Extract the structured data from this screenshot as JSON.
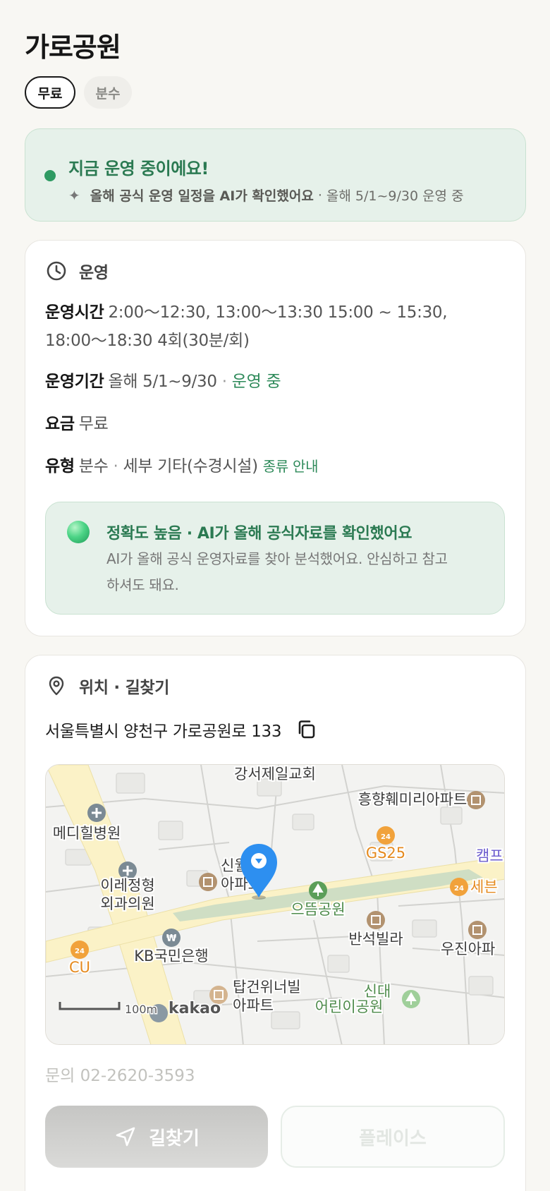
{
  "place": {
    "title": "가로공원",
    "chips": [
      {
        "label": "무료",
        "active": true
      },
      {
        "label": "분수",
        "active": false
      }
    ]
  },
  "status": {
    "title": "지금 운영 중이에요!",
    "ai_note": "올해 공식 운영 일정을 AI가 확인했어요",
    "dot_sep": "·",
    "period_note": "올해 5/1~9/30 운영 중",
    "accent_color": "#2b7a52"
  },
  "operation": {
    "section_label": "운영",
    "hours_key": "운영시간",
    "hours_value": "2:00～12:30, 13:00～13:30 15:00 ~ 15:30, 18:00～18:30 4회(30분/회)",
    "period_key": "운영기간",
    "period_value": "올해 5/1~9/30",
    "period_sep": "·",
    "period_status": "운영 중",
    "fee_key": "요금",
    "fee_value": "무료",
    "type_key": "유형",
    "type_value": "분수",
    "type_sep": "·",
    "type_detail": "세부 기타(수경시설)",
    "type_link": "종류 안내",
    "accuracy_title": "정확도 높음 · AI가 올해 공식자료를 확인했어요",
    "accuracy_body": "AI가 올해 공식 운영자료를 찾아 분석했어요. 안심하고 참고하셔도 돼요."
  },
  "location": {
    "section_label": "위치 · 길찾기",
    "address": "서울특별시 양천구 가로공원로 133",
    "map_labels": {
      "church": "강서제일교회",
      "apt1": "흥향훼미리아파트",
      "hospital": "메디힐병원",
      "gs25": "GS25",
      "camp": "캠프",
      "clinic_l1": "이레정형",
      "clinic_l2": "외과의원",
      "sinwol_l1": "신월하",
      "sinwol_l2": "아파트",
      "park": "으뜸공원",
      "seven": "세븐",
      "banseok": "반석빌라",
      "ujin": "우진아파",
      "kb": "KB국민은행",
      "cu": "CU",
      "tapgeon_l1": "탑건위너빌",
      "tapgeon_l2": "아파트",
      "sindae_l1": "신대",
      "sindae_l2": "어린이공원",
      "scale": "100m",
      "brand": "kakao"
    },
    "phone": "문의 02-2620-3593",
    "directions_label": "길찾기",
    "place_label": "플레이스"
  },
  "icons": [
    "clock-icon",
    "location-pin-icon",
    "copy-icon",
    "navigation-arrow-icon",
    "sparkle-icon",
    "map-marker-icon"
  ]
}
